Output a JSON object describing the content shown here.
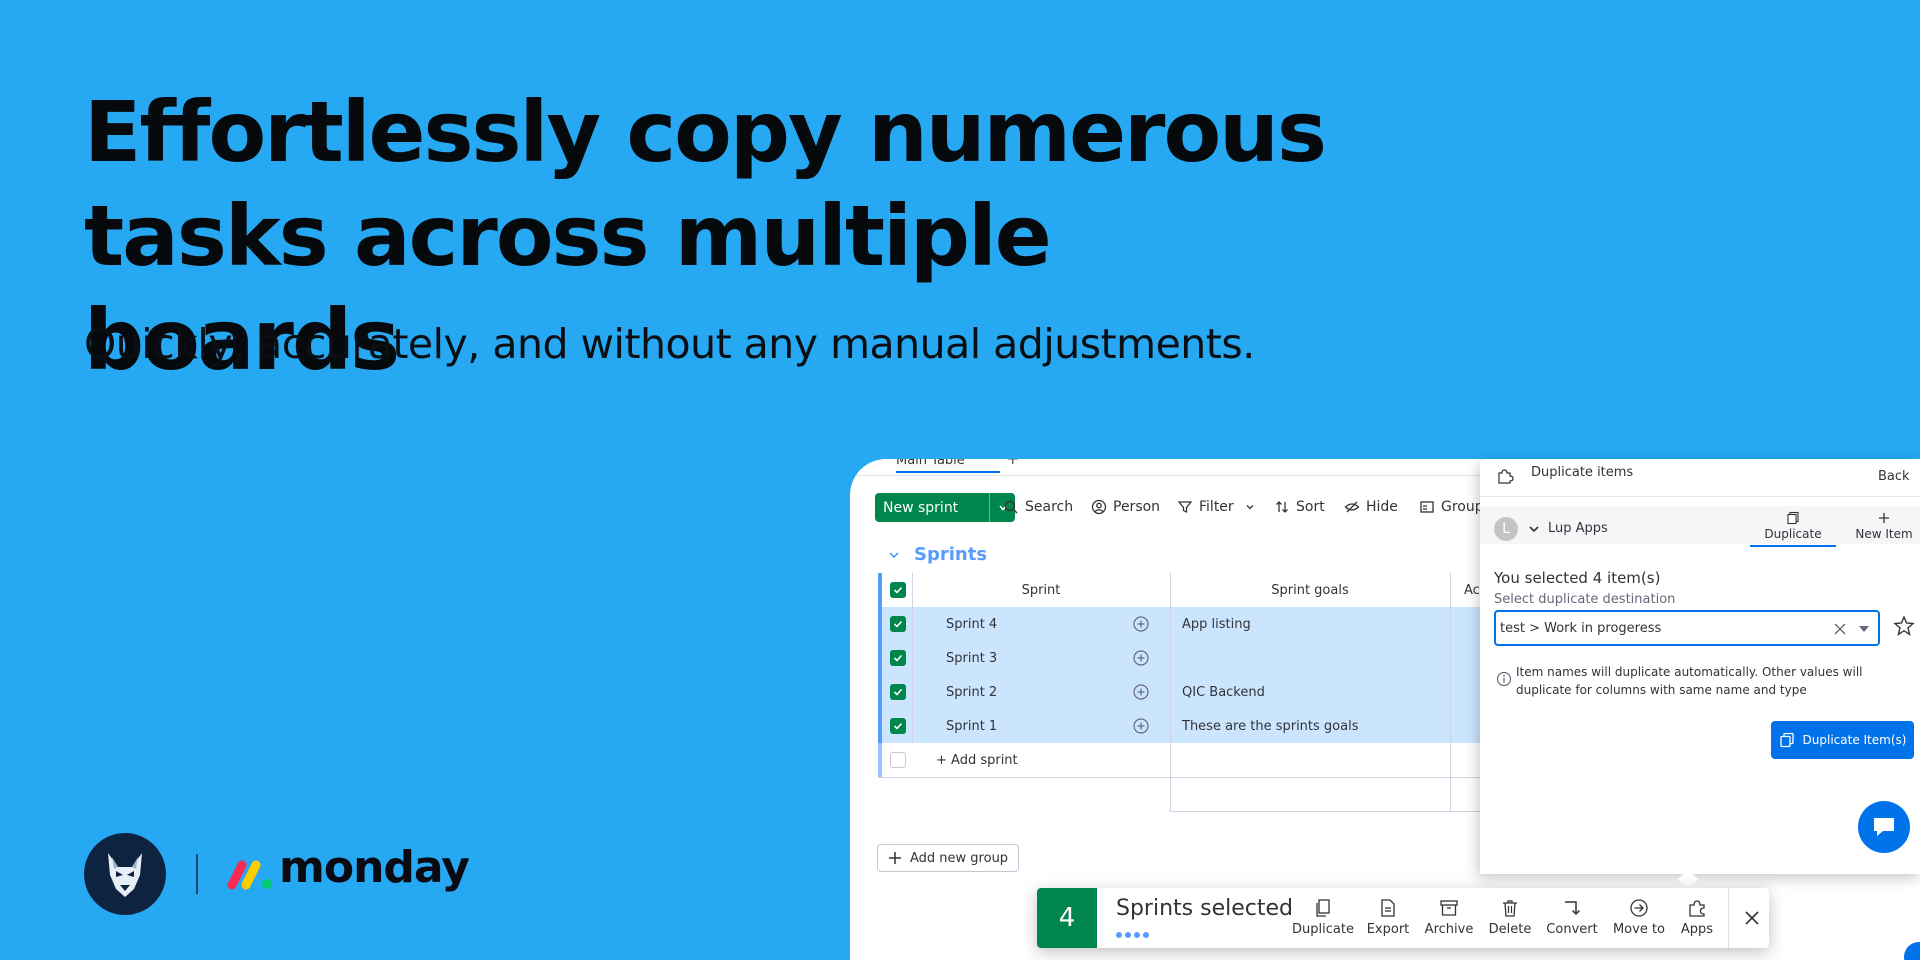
{
  "hero": {
    "headline": "Effortlessly copy numerous tasks across multiple boards",
    "subline": "Quickly, accurately, and without any manual adjustments."
  },
  "brand": {
    "monday_text": "monday",
    "colors": {
      "background": "#27a8f3",
      "green": "#00854d",
      "blue": "#0073ea"
    }
  },
  "board": {
    "tab_label": "Main Table",
    "tab_add": "+",
    "new_button": "New sprint",
    "toolbar": [
      "Search",
      "Person",
      "Filter",
      "Sort",
      "Hide",
      "Group"
    ],
    "group_title": "Sprints",
    "columns": {
      "sprint": "Sprint",
      "goals": "Sprint goals",
      "actions": "Ac"
    },
    "rows": [
      {
        "name": "Sprint 4",
        "goal": "App listing"
      },
      {
        "name": "Sprint 3",
        "goal": ""
      },
      {
        "name": "Sprint 2",
        "goal": "QIC Backend"
      },
      {
        "name": "Sprint 1",
        "goal": "These are the sprints goals"
      }
    ],
    "add_row": "+ Add sprint",
    "add_group": "Add new group"
  },
  "action_bar": {
    "count": "4",
    "selected_text": "Sprints selected",
    "actions": [
      "Duplicate",
      "Export",
      "Archive",
      "Delete",
      "Convert",
      "Move to",
      "Apps"
    ]
  },
  "dup_panel": {
    "title": "Duplicate items",
    "back": "Back",
    "avatar_letter": "L",
    "account": "Lup Apps",
    "tabs": [
      "Duplicate",
      "New Item"
    ],
    "selected_count": "You selected 4 item(s)",
    "dest_label": "Select duplicate destination",
    "dest_value": "test > Work in progeress",
    "info": "Item names will duplicate automatically. Other values will duplicate for columns with same name and type",
    "button": "Duplicate Item(s)"
  }
}
